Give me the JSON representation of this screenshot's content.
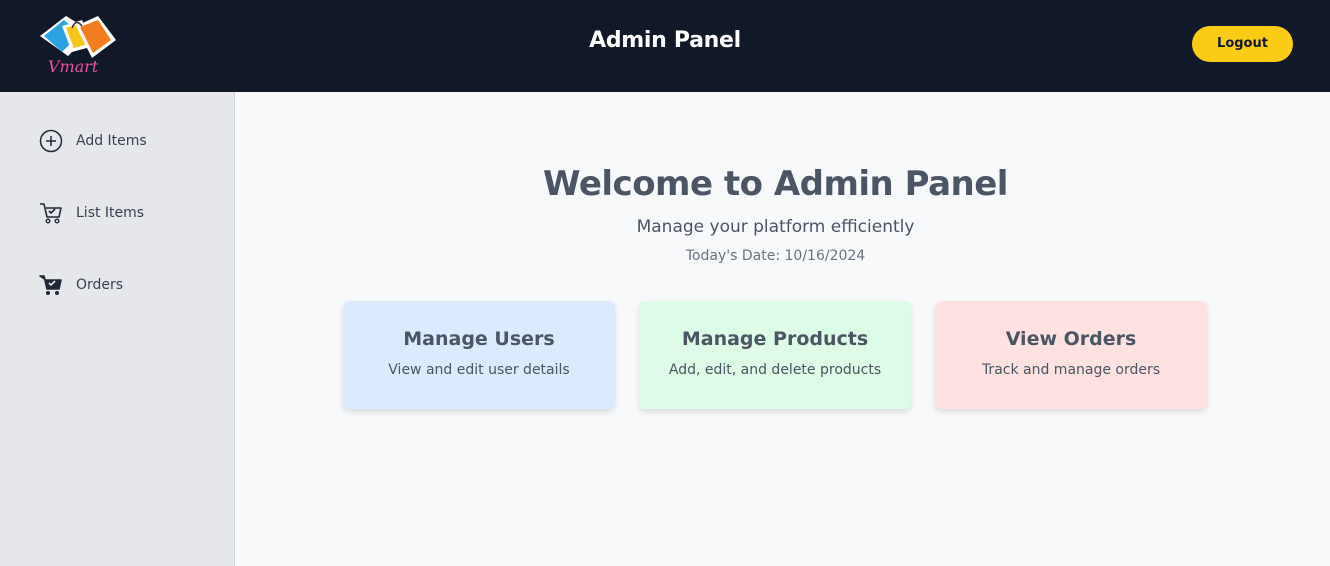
{
  "header": {
    "logo_text": "Vmart",
    "title": "Admin Panel",
    "logout_label": "Logout"
  },
  "sidebar": {
    "items": [
      {
        "label": "Add Items",
        "icon": "plus-circle-icon"
      },
      {
        "label": "List Items",
        "icon": "cart-check-icon"
      },
      {
        "label": "Orders",
        "icon": "cart-filled-icon"
      }
    ]
  },
  "main": {
    "heading": "Welcome to Admin Panel",
    "subtitle": "Manage your platform efficiently",
    "date_text": "Today's Date: 10/16/2024",
    "cards": [
      {
        "title": "Manage Users",
        "description": "View and edit user details",
        "color": "#dbeafe"
      },
      {
        "title": "Manage Products",
        "description": "Add, edit, and delete products",
        "color": "#dcfce7"
      },
      {
        "title": "View Orders",
        "description": "Track and manage orders",
        "color": "#fee2e2"
      }
    ]
  },
  "colors": {
    "header_bg": "#111827",
    "accent": "#facc15",
    "sidebar_bg": "#e5e7eb",
    "page_bg": "#f8f9fb"
  }
}
